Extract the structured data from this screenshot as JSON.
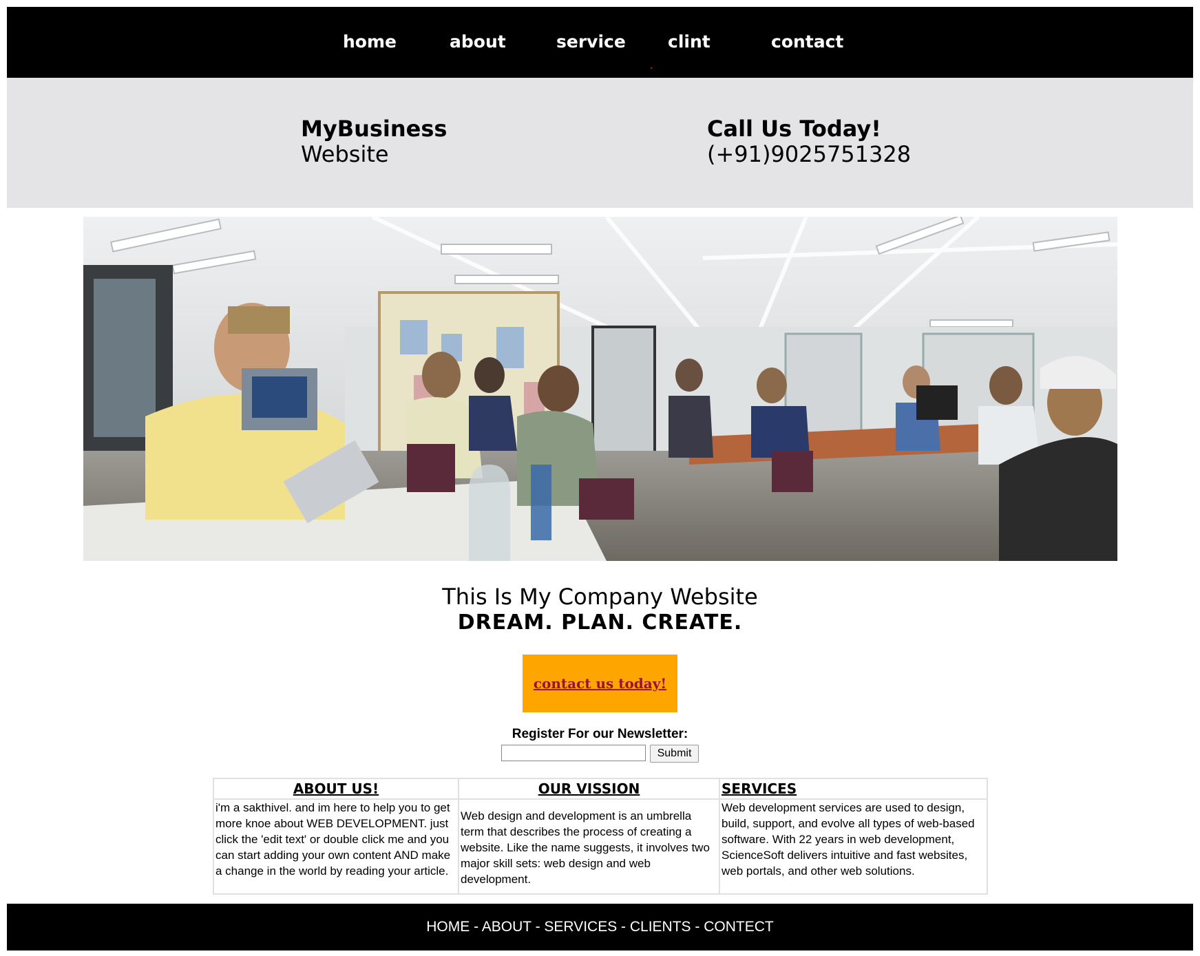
{
  "nav": {
    "items": [
      {
        "label": "home"
      },
      {
        "label": "about"
      },
      {
        "label": "service"
      },
      {
        "label": "clint"
      },
      {
        "label": "contact"
      }
    ]
  },
  "header": {
    "brand_line1": "MyBusiness",
    "brand_line2": "Website",
    "call_line1": "Call Us Today!",
    "call_line2": "(+91)9025751328"
  },
  "hero": {
    "image_description": "office meeting room photo"
  },
  "tagline": {
    "line1": "This Is My Company Website",
    "line2": "DREAM. PLAN. CREATE."
  },
  "cta": {
    "label": "contact us today!",
    "color": "#ffa500"
  },
  "newsletter": {
    "label": "Register For our Newsletter:",
    "input_value": "",
    "submit_label": "Submit"
  },
  "info": {
    "about": {
      "title": "ABOUT US!",
      "text": "i'm a sakthivel. and im here to help you to get more knoe about WEB DEVELOPMENT. just click the 'edit text' or double click me and you can start adding your own content AND make a change in the world by reading your article."
    },
    "vision": {
      "title": "OUR VISSION",
      "text": "Web design and development is an umbrella term that describes the process of creating a website. Like the name suggests, it involves two major skill sets: web design and web development."
    },
    "services": {
      "title": "SERVICES",
      "text": "Web development services are used to design, build, support, and evolve all types of web-based software. With 22 years in web development, ScienceSoft delivers intuitive and fast websites, web portals, and other web solutions."
    }
  },
  "footer": {
    "text": "HOME - ABOUT - SERVICES - CLIENTS - CONTECT"
  }
}
